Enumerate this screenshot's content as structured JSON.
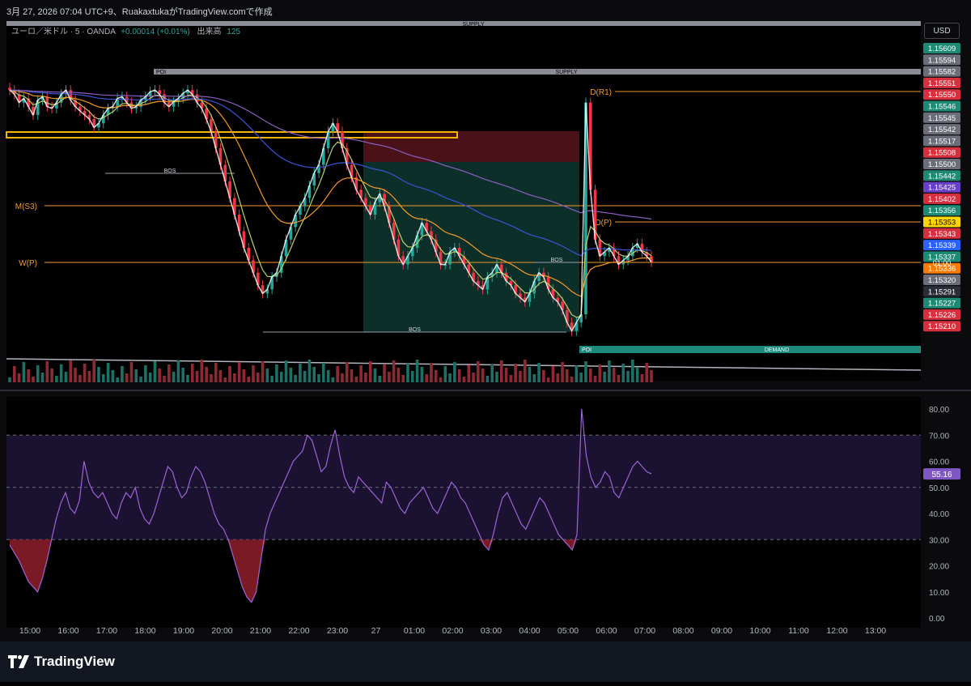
{
  "header": {
    "title": "3月 27, 2026 07:04 UTC+9、RuakaxtukaがTradingView.comで作成",
    "symbol": "ユーロ／米ドル · 5 · OANDA",
    "change": "+0.00014 (+0.01%)",
    "volume_label": "出来高",
    "volume_value": "125",
    "currency": "USD"
  },
  "brand": {
    "name": "TradingView"
  },
  "colors": {
    "bull": "#26a69a",
    "bear": "#f23645",
    "zigzag": "#ffffff",
    "ema_fast": "#b8d26a",
    "ema_mid": "#f59b2b",
    "ema_slow": "#3a55d6",
    "ema_long": "#8c5fc0",
    "pivot": "#f59b2b",
    "rsi": "#9d64d6",
    "zone_short": "#4a1218",
    "zone_long": "#0c2f2a"
  },
  "chart_data": {
    "type": "candlestick",
    "x_ticks": [
      "15:00",
      "16:00",
      "17:00",
      "18:00",
      "19:00",
      "20:00",
      "21:00",
      "22:00",
      "23:00",
      "27",
      "01:00",
      "02:00",
      "03:00",
      "04:00",
      "05:00",
      "06:00",
      "07:00",
      "08:00",
      "09:00",
      "10:00",
      "11:00",
      "12:00",
      "13:00"
    ],
    "price_axis": {
      "min": 1.1521,
      "max": 1.1561,
      "labels": [
        {
          "value": "1.15609",
          "color": "#1f8a73"
        },
        {
          "value": "1.15594",
          "color": "#6b6e78"
        },
        {
          "value": "1.15582",
          "color": "#6b6e78"
        },
        {
          "value": "1.15551",
          "color": "#d6303e"
        },
        {
          "value": "1.15550",
          "color": "#d6303e"
        },
        {
          "value": "1.15546",
          "color": "#1f8a73"
        },
        {
          "value": "1.15545",
          "color": "#6b6e78"
        },
        {
          "value": "1.15542",
          "color": "#6b6e78"
        },
        {
          "value": "1.15517",
          "color": "#6b6e78"
        },
        {
          "value": "1.15508",
          "color": "#d6303e"
        },
        {
          "value": "1.15500",
          "color": "#6b6e78"
        },
        {
          "value": "1.15442",
          "color": "#1f8a73"
        },
        {
          "value": "1.15425",
          "color": "#6a3fc7"
        },
        {
          "value": "1.15402",
          "color": "#d6303e"
        },
        {
          "value": "1.15356",
          "color": "#1f8a73"
        },
        {
          "value": "1.15353",
          "color": "#ffd600",
          "text": "#000000"
        },
        {
          "value": "1.15343",
          "color": "#d6303e"
        },
        {
          "value": "1.15339",
          "color": "#2962ff"
        },
        {
          "value": "1.15337",
          "color": "#1f8a73"
        },
        {
          "value": "1.15336",
          "color": "#f57c00"
        },
        {
          "value": "1.15320",
          "color": "#6b6e78"
        },
        {
          "value": "1.15291",
          "color": "#2a2e39"
        },
        {
          "value": "1.15227",
          "color": "#1f8a73"
        },
        {
          "value": "1.15226",
          "color": "#d6303e"
        },
        {
          "value": "1.15210",
          "color": "#d6303e"
        }
      ],
      "countdown": "01:00"
    },
    "pivot_levels": [
      {
        "label": "D(R1)",
        "value": 1.1555
      },
      {
        "label": "M(S3)",
        "value": 1.15425
      },
      {
        "label": "D(P)",
        "value": 1.15402
      },
      {
        "label": "W(P)",
        "value": 1.15336
      }
    ],
    "zones": [
      {
        "label": "SUPPLY",
        "value": 1.1561
      },
      {
        "label": "SUPPLY",
        "value": 1.1558
      },
      {
        "label": "POI",
        "value": 1.1558
      },
      {
        "label": "DEMAND",
        "value": 1.1523
      },
      {
        "label": "POI",
        "value": 1.1523
      }
    ],
    "structure_labels": [
      "BOS",
      "BOS",
      "BOS"
    ],
    "close": [
      1.1556,
      1.15555,
      1.15545,
      1.1555,
      1.1554,
      1.1553,
      1.15548,
      1.15552,
      1.1554,
      1.15538,
      1.15545,
      1.15555,
      1.1556,
      1.15548,
      1.1554,
      1.15535,
      1.1553,
      1.15525,
      1.15515,
      1.1552,
      1.1553,
      1.15538,
      1.1554,
      1.1555,
      1.15552,
      1.15545,
      1.15538,
      1.1554,
      1.15548,
      1.15552,
      1.15558,
      1.1556,
      1.15555,
      1.15545,
      1.1554,
      1.15546,
      1.1555,
      1.15556,
      1.1556,
      1.15555,
      1.15545,
      1.15538,
      1.15525,
      1.1551,
      1.1549,
      1.1547,
      1.1545,
      1.1543,
      1.1541,
      1.1539,
      1.1537,
      1.15355,
      1.1534,
      1.15325,
      1.15315,
      1.1532,
      1.15335,
      1.1534,
      1.1536,
      1.1538,
      1.15395,
      1.1541,
      1.1542,
      1.1543,
      1.15445,
      1.1546,
      1.1547,
      1.1549,
      1.1551,
      1.1552,
      1.1551,
      1.1549,
      1.1547,
      1.15455,
      1.1544,
      1.1543,
      1.1542,
      1.1541,
      1.15425,
      1.15435,
      1.1542,
      1.154,
      1.1538,
      1.1536,
      1.1535,
      1.1536,
      1.1537,
      1.15385,
      1.154,
      1.1539,
      1.1538,
      1.15365,
      1.1535,
      1.1535,
      1.15365,
      1.1537,
      1.1536,
      1.1535,
      1.1534,
      1.1533,
      1.15325,
      1.1532,
      1.15335,
      1.1534,
      1.1535,
      1.1534,
      1.1533,
      1.15325,
      1.15315,
      1.1531,
      1.15305,
      1.15315,
      1.1533,
      1.1534,
      1.15335,
      1.1532,
      1.1531,
      1.15305,
      1.15295,
      1.1528,
      1.1527,
      1.1528,
      1.1529,
      1.15545,
      1.1544,
      1.1538,
      1.1536,
      1.15365,
      1.1537,
      1.1536,
      1.1535,
      1.15355,
      1.1536,
      1.1537,
      1.15375,
      1.15365,
      1.1536,
      1.15353
    ],
    "rsi": {
      "value": "55.16",
      "ticks": [
        "80.00",
        "70.00",
        "60.00",
        "50.00",
        "40.00",
        "30.00",
        "20.00",
        "10.00",
        "0.00"
      ],
      "upper": 70,
      "lower": 30,
      "ylim": [
        0,
        80
      ],
      "values": [
        28,
        25,
        22,
        18,
        14,
        12,
        10,
        15,
        22,
        30,
        38,
        44,
        48,
        42,
        40,
        45,
        60,
        52,
        48,
        46,
        48,
        44,
        40,
        38,
        44,
        48,
        46,
        50,
        42,
        38,
        36,
        40,
        46,
        52,
        58,
        56,
        50,
        46,
        48,
        54,
        58,
        56,
        52,
        46,
        40,
        36,
        34,
        30,
        24,
        18,
        12,
        8,
        6,
        10,
        22,
        34,
        40,
        44,
        48,
        52,
        56,
        60,
        62,
        64,
        70,
        68,
        62,
        56,
        58,
        66,
        72,
        62,
        54,
        50,
        48,
        54,
        52,
        50,
        48,
        46,
        44,
        52,
        50,
        46,
        42,
        40,
        44,
        46,
        48,
        50,
        46,
        42,
        40,
        44,
        48,
        52,
        50,
        46,
        44,
        40,
        36,
        32,
        28,
        26,
        32,
        40,
        46,
        48,
        44,
        40,
        36,
        34,
        38,
        42,
        46,
        44,
        40,
        36,
        32,
        30,
        28,
        26,
        32,
        80,
        62,
        54,
        50,
        52,
        56,
        54,
        48,
        46,
        50,
        54,
        58,
        60,
        58,
        56,
        55.16
      ]
    }
  }
}
